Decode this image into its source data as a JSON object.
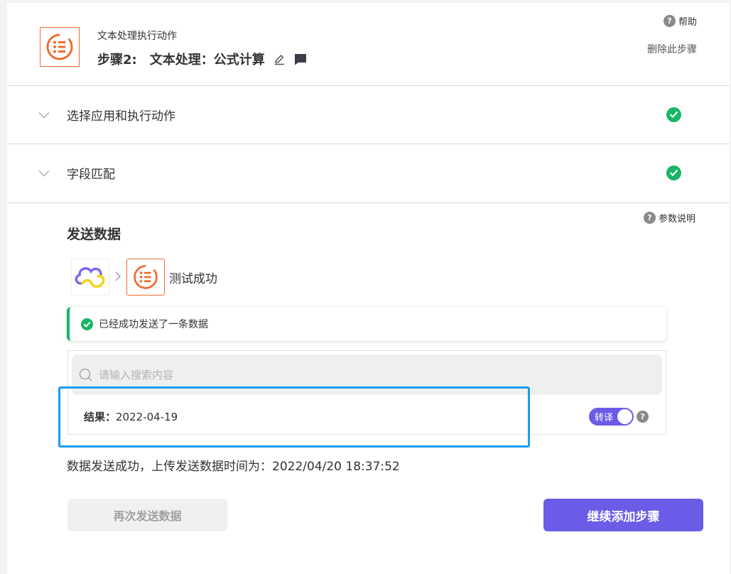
{
  "header": {
    "subtitle": "文本处理执行动作",
    "step_label": "步骤2:",
    "step_title": "文本处理：公式计算",
    "help_label": "帮助",
    "delete_step_label": "删除此步骤"
  },
  "sections": [
    {
      "label": "选择应用和执行动作",
      "status": "complete"
    },
    {
      "label": "字段匹配",
      "status": "complete"
    }
  ],
  "send_data": {
    "title": "发送数据",
    "param_help_label": "参数说明",
    "flow_status": "测试成功",
    "success_message": "已经成功发送了一条数据",
    "search_placeholder": "请输入搜索内容",
    "result_label": "结果：",
    "result_value": "2022-04-19",
    "toggle_label": "转译",
    "toggle_on": true,
    "upload_status": "数据发送成功，上传发送数据时间为：2022/04/20 18:37:52"
  },
  "actions": {
    "resend_label": "再次发送数据",
    "continue_label": "继续添加步骤"
  },
  "colors": {
    "accent": "#6b5ce7",
    "success": "#18b566",
    "brand_orange": "#ef6c2f",
    "highlight": "#1a9cf0"
  }
}
